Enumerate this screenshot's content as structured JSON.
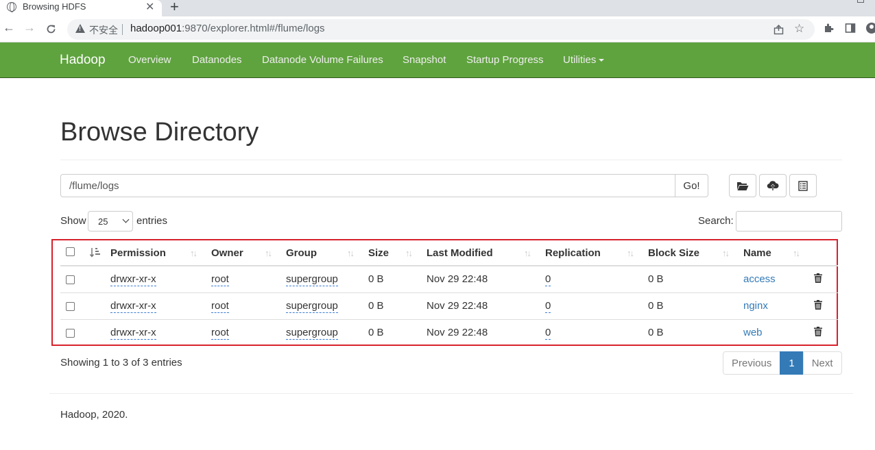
{
  "browser": {
    "tab_title": "Browsing HDFS",
    "tab_close": "✕",
    "new_tab": "+",
    "insecure_label": "不安全",
    "url_host": "hadoop001",
    "url_rest": ":9870/explorer.html#/flume/logs"
  },
  "navbar": {
    "brand": "Hadoop",
    "links": [
      "Overview",
      "Datanodes",
      "Datanode Volume Failures",
      "Snapshot",
      "Startup Progress",
      "Utilities"
    ]
  },
  "page": {
    "title": "Browse Directory",
    "path_value": "/flume/logs",
    "go_label": "Go!",
    "show_label": "Show",
    "entries_value": "25",
    "entries_label": "entries",
    "search_label": "Search:"
  },
  "table": {
    "headers": [
      "Permission",
      "Owner",
      "Group",
      "Size",
      "Last Modified",
      "Replication",
      "Block Size",
      "Name"
    ],
    "rows": [
      {
        "permission": "drwxr-xr-x",
        "owner": "root",
        "group": "supergroup",
        "size": "0 B",
        "modified": "Nov 29 22:48",
        "replication": "0",
        "block_size": "0 B",
        "name": "access"
      },
      {
        "permission": "drwxr-xr-x",
        "owner": "root",
        "group": "supergroup",
        "size": "0 B",
        "modified": "Nov 29 22:48",
        "replication": "0",
        "block_size": "0 B",
        "name": "nginx"
      },
      {
        "permission": "drwxr-xr-x",
        "owner": "root",
        "group": "supergroup",
        "size": "0 B",
        "modified": "Nov 29 22:48",
        "replication": "0",
        "block_size": "0 B",
        "name": "web"
      }
    ]
  },
  "pagination": {
    "showing": "Showing 1 to 3 of 3 entries",
    "previous": "Previous",
    "current": "1",
    "next": "Next"
  },
  "footer": {
    "text": "Hadoop, 2020."
  },
  "colors": {
    "navbar": "#5fa33e",
    "link": "#337ab7",
    "highlight": "#d6202a"
  }
}
